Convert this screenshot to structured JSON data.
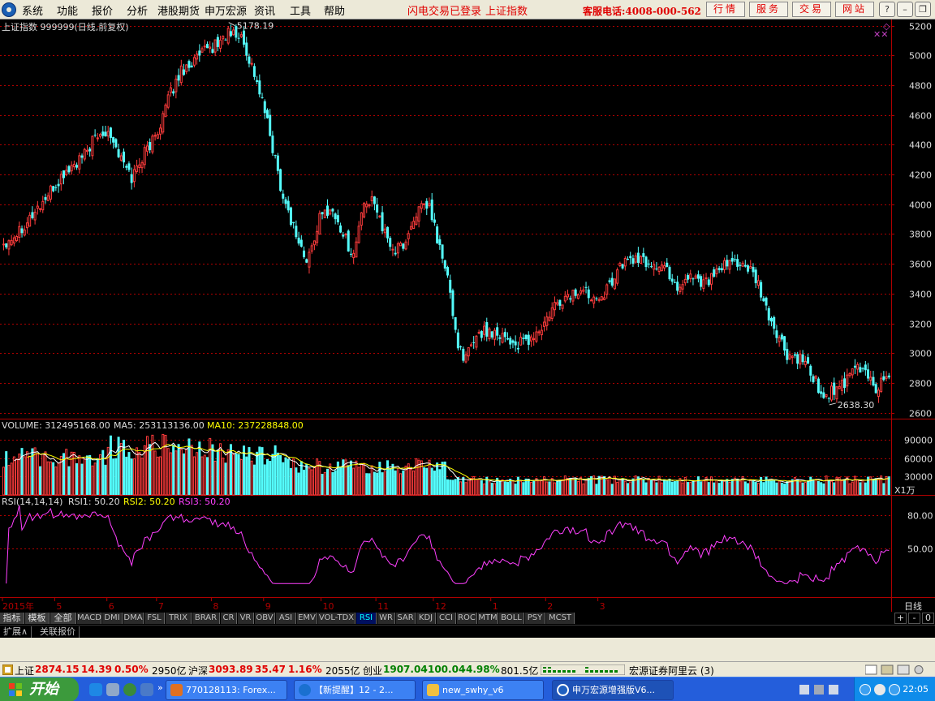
{
  "menu": {
    "items": [
      "系统",
      "功能",
      "报价",
      "分析",
      "港股期货",
      "申万宏源",
      "资讯",
      "工具",
      "帮助"
    ],
    "flash_login": "闪电交易已登录",
    "current_index": "上证指数",
    "phone": "客服电话:4008-000-562",
    "buttons": [
      "行情",
      "服务",
      "交易",
      "网站"
    ]
  },
  "window_controls": [
    "?",
    "–",
    "❐",
    "✕"
  ],
  "chart_data": {
    "type": "candlestick",
    "title": "上证指数 999999(日线,前复权)",
    "period": "日线",
    "y_ticks": [
      5200,
      5000,
      4800,
      4600,
      4400,
      4200,
      4000,
      3800,
      3600,
      3400,
      3200,
      3000,
      2800,
      2600
    ],
    "ylim": [
      2560,
      5230
    ],
    "x_labels": [
      "2015年",
      "5",
      "6",
      "7",
      "8",
      "9",
      "10",
      "11",
      "12",
      "1",
      "2",
      "3"
    ],
    "max_label": "5178.19",
    "min_label": "2638.30",
    "anchors": [
      [
        0,
        3740
      ],
      [
        5,
        3810
      ],
      [
        12,
        3950
      ],
      [
        18,
        4080
      ],
      [
        24,
        4220
      ],
      [
        30,
        4300
      ],
      [
        34,
        4420
      ],
      [
        40,
        4510
      ],
      [
        45,
        4300
      ],
      [
        49,
        4180
      ],
      [
        54,
        4350
      ],
      [
        58,
        4450
      ],
      [
        63,
        4700
      ],
      [
        68,
        4900
      ],
      [
        72,
        4950
      ],
      [
        77,
        5020
      ],
      [
        82,
        5080
      ],
      [
        86,
        5150
      ],
      [
        91,
        5120
      ],
      [
        96,
        4880
      ],
      [
        100,
        4620
      ],
      [
        104,
        4300
      ],
      [
        107,
        4050
      ],
      [
        111,
        3850
      ],
      [
        116,
        3600
      ],
      [
        121,
        3900
      ],
      [
        125,
        3980
      ],
      [
        130,
        3800
      ],
      [
        134,
        3650
      ],
      [
        137,
        3950
      ],
      [
        142,
        4040
      ],
      [
        146,
        3790
      ],
      [
        150,
        3680
      ],
      [
        154,
        3750
      ],
      [
        158,
        3950
      ],
      [
        163,
        3980
      ],
      [
        167,
        3700
      ],
      [
        170,
        3500
      ],
      [
        173,
        3150
      ],
      [
        176,
        2930
      ],
      [
        181,
        3130
      ],
      [
        186,
        3150
      ],
      [
        191,
        3130
      ],
      [
        196,
        3050
      ],
      [
        201,
        3080
      ],
      [
        206,
        3160
      ],
      [
        211,
        3310
      ],
      [
        216,
        3380
      ],
      [
        221,
        3420
      ],
      [
        226,
        3390
      ],
      [
        231,
        3420
      ],
      [
        235,
        3560
      ],
      [
        240,
        3640
      ],
      [
        245,
        3610
      ],
      [
        250,
        3590
      ],
      [
        254,
        3560
      ],
      [
        258,
        3440
      ],
      [
        263,
        3530
      ],
      [
        268,
        3480
      ],
      [
        272,
        3510
      ],
      [
        276,
        3580
      ],
      [
        281,
        3620
      ],
      [
        286,
        3540
      ],
      [
        289,
        3450
      ],
      [
        292,
        3280
      ],
      [
        296,
        3130
      ],
      [
        300,
        2980
      ],
      [
        305,
        2950
      ],
      [
        309,
        2870
      ],
      [
        314,
        2700
      ],
      [
        318,
        2760
      ],
      [
        322,
        2780
      ],
      [
        326,
        2900
      ],
      [
        330,
        2880
      ],
      [
        334,
        2760
      ],
      [
        339,
        2870
      ]
    ],
    "volume": {
      "label": "VOLUME: 312495168.00",
      "ma5_label": "MA5: 253113136.00",
      "ma10_label": "MA10: 237228848.00",
      "y_ticks": [
        90000,
        60000,
        30000
      ],
      "unit": "X1万"
    },
    "rsi": {
      "label": "RSI(14,14,14)",
      "rsi1_label": "RSI1: 50.20",
      "rsi2_label": "RSI2: 50.20",
      "rsi3_label": "RSI3: 50.20",
      "y_ticks": [
        "80.00",
        "50.00"
      ]
    },
    "colors": {
      "up": "#ff3c3c",
      "down": "#54fcfc",
      "grid": "#b00000",
      "ma5": "#ffffff",
      "ma10": "#ffff00",
      "rsi": "#ff40ff"
    }
  },
  "indicator_tabs": [
    "指标",
    "模板",
    "全部",
    "MACD",
    "DMI",
    "DMA",
    "FSL",
    "TRIX",
    "BRAR",
    "CR",
    "VR",
    "OBV",
    "ASI",
    "EMV",
    "VOL-TDX",
    "RSI",
    "WR",
    "SAR",
    "KDJ",
    "CCI",
    "ROC",
    "MTM",
    "BOLL",
    "PSY",
    "MCST"
  ],
  "active_indicator": "RSI",
  "indicator_controls": [
    "+",
    "-",
    "0"
  ],
  "ext_tabs": [
    "扩展∧",
    "关联报价"
  ],
  "ticker": {
    "sh_name": "上证",
    "sh_value": "2874.15",
    "sh_change": "14.39",
    "sh_pct": "0.50%",
    "sh_amount": "2950亿",
    "hs_name": "沪深",
    "hs_value": "3093.89",
    "hs_change": "35.47",
    "hs_pct": "1.16%",
    "hs_amount": "2055亿",
    "cy_name": "创业",
    "cy_value": "1907.04",
    "cy_change": "-100.04",
    "cy_pct": "-4.98%",
    "cy_amount": "801.5亿",
    "broker": "宏源证券阿里云 (3)"
  },
  "taskbar": {
    "start": "开始",
    "tasks": [
      "770128113: Forex...",
      "【新提醒】12 - 2...",
      "new_swhy_v6",
      "申万宏源增强版V6..."
    ],
    "clock": "22:05"
  }
}
